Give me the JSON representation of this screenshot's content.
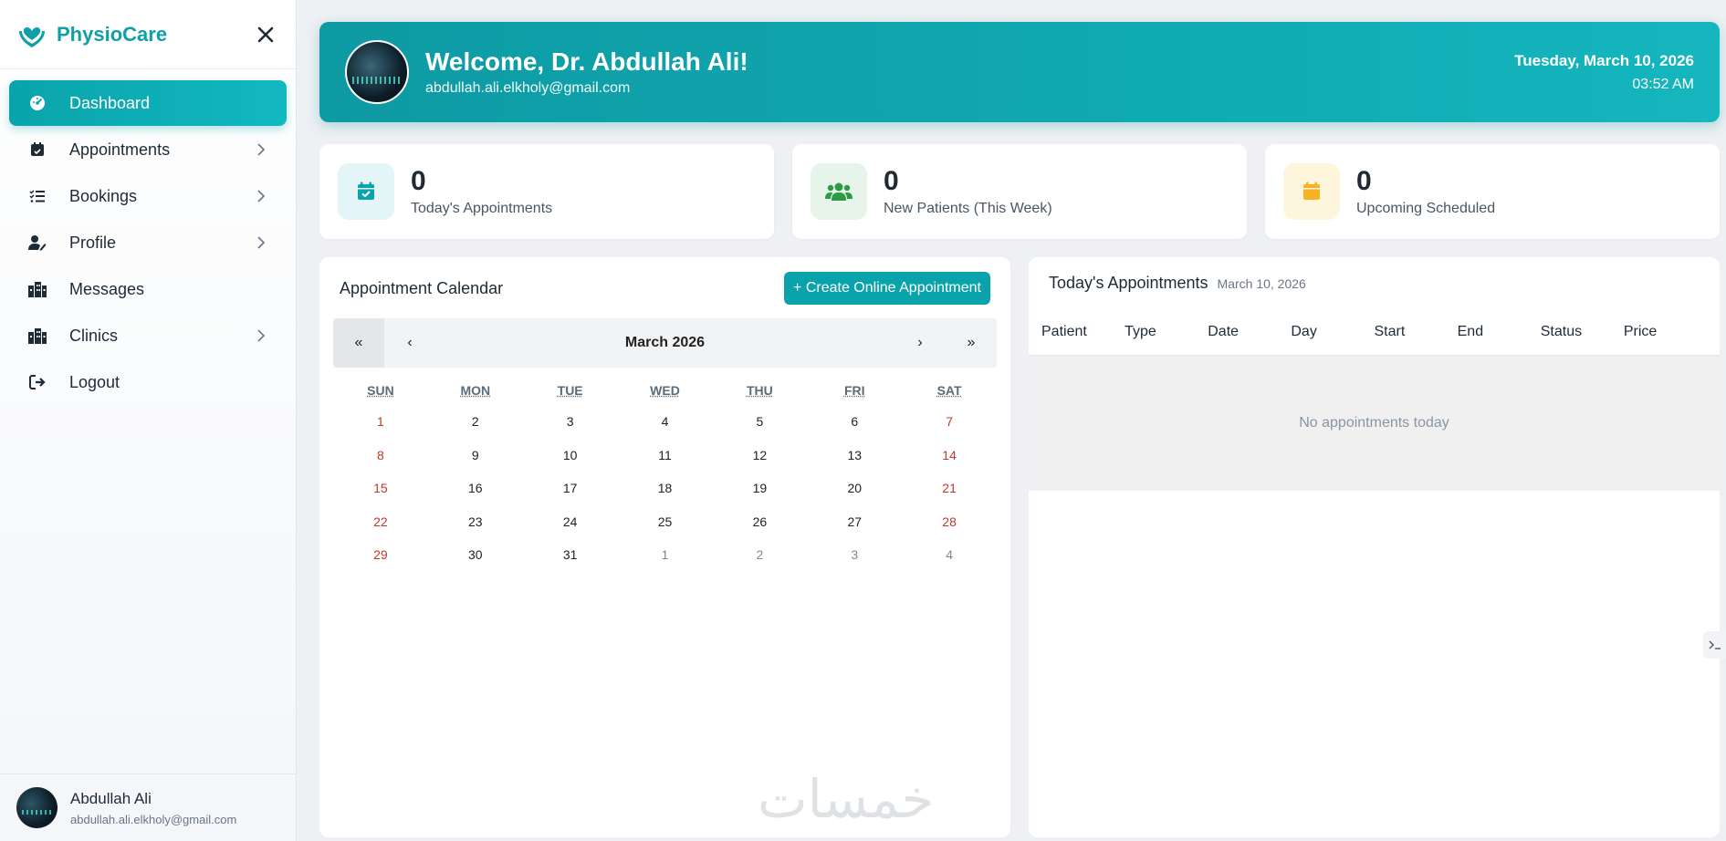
{
  "brand": {
    "name": "PhysioCare"
  },
  "sidebar": {
    "items": [
      {
        "label": "Dashboard",
        "icon": "dashboard-icon"
      },
      {
        "label": "Appointments",
        "icon": "calendar-check-icon"
      },
      {
        "label": "Bookings",
        "icon": "list-check-icon"
      },
      {
        "label": "Profile",
        "icon": "user-edit-icon"
      },
      {
        "label": "Messages",
        "icon": "building-icon"
      },
      {
        "label": "Clinics",
        "icon": "building-icon"
      },
      {
        "label": "Logout",
        "icon": "logout-icon"
      }
    ],
    "user": {
      "name": "Abdullah Ali",
      "email": "abdullah.ali.elkholy@gmail.com"
    }
  },
  "header": {
    "title": "Welcome, Dr. Abdullah Ali!",
    "email": "abdullah.ali.elkholy@gmail.com",
    "date": "Tuesday, March 10, 2026",
    "time": "03:52 AM"
  },
  "stats": [
    {
      "value": "0",
      "label": "Today's Appointments",
      "icon": "calendar-check-icon",
      "color": "#0aa3ab",
      "bg": "#e3f5f7"
    },
    {
      "value": "0",
      "label": "New Patients (This Week)",
      "icon": "users-icon",
      "color": "#2e9a48",
      "bg": "#e6f4ea"
    },
    {
      "value": "0",
      "label": "Upcoming Scheduled",
      "icon": "calendar-icon",
      "color": "#f5b324",
      "bg": "#fdf6dc"
    }
  ],
  "calendar": {
    "title": "Appointment Calendar",
    "create_label": "+ Create Online Appointment",
    "month": "March 2026",
    "nav": {
      "prev_year": "«",
      "prev": "‹",
      "next": "›",
      "next_year": "»"
    },
    "weekdays": [
      "SUN",
      "MON",
      "TUE",
      "WED",
      "THU",
      "FRI",
      "SAT"
    ],
    "weeks": [
      [
        "1",
        "2",
        "3",
        "4",
        "5",
        "6",
        "7"
      ],
      [
        "8",
        "9",
        "10",
        "11",
        "12",
        "13",
        "14"
      ],
      [
        "15",
        "16",
        "17",
        "18",
        "19",
        "20",
        "21"
      ],
      [
        "22",
        "23",
        "24",
        "25",
        "26",
        "27",
        "28"
      ],
      [
        "29",
        "30",
        "31",
        "1",
        "2",
        "3",
        "4"
      ]
    ],
    "watermark": "خمسات"
  },
  "appointments": {
    "title": "Today's Appointments",
    "date": "March 10, 2026",
    "columns": [
      "Patient",
      "Type",
      "Date",
      "Day",
      "Start",
      "End",
      "Status",
      "Price"
    ],
    "empty_text": "No appointments today"
  },
  "colors": {
    "accent": "#0aa3ab",
    "weekend": "#c0392b"
  }
}
